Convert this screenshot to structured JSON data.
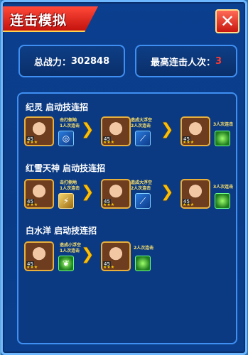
{
  "title": "连击模拟",
  "close_label": "✕",
  "stats": {
    "power_label": "总战力：",
    "power_value": "302848",
    "max_combo_label": "最高连击人次：",
    "max_combo_value": "3"
  },
  "combos": [
    {
      "title": "纪灵  启动技连招",
      "steps": [
        {
          "hero": "hero-ji-ling",
          "level": "45",
          "skill": "blue",
          "skill_icon": "swirl-icon",
          "desc": [
            "击打侧地",
            "1人次连击"
          ]
        },
        {
          "hero": "hero-red-hair",
          "level": "45",
          "skill": "blue",
          "skill_icon": "slash-icon",
          "desc": [
            "造成大浮空",
            "2人次连击"
          ]
        },
        {
          "hero": "hero-green-warrior",
          "level": "45",
          "skill": "green",
          "skill_icon": "orb-icon",
          "desc": [
            "3人次连击"
          ]
        }
      ]
    },
    {
      "title": "红雪天神  启动技连招",
      "steps": [
        {
          "hero": "hero-red-snow",
          "level": "45",
          "skill": "gold",
          "skill_icon": "lightning-icon",
          "desc": [
            "击打侧地",
            "1人次连击"
          ]
        },
        {
          "hero": "hero-red-hair",
          "level": "45",
          "skill": "blue",
          "skill_icon": "slash-icon",
          "desc": [
            "造成大浮空",
            "2人次连击"
          ]
        },
        {
          "hero": "hero-green-warrior",
          "level": "45",
          "skill": "green",
          "skill_icon": "orb-icon",
          "desc": [
            "3人次连击"
          ]
        }
      ]
    },
    {
      "title": "白水洋  启动技连招",
      "steps": [
        {
          "hero": "hero-white-hair",
          "level": "45",
          "skill": "green",
          "skill_icon": "leaf-icon",
          "desc": [
            "造成小浮空",
            "1人次连击"
          ]
        },
        {
          "hero": "hero-green-warrior",
          "level": "45",
          "skill": "green",
          "skill_icon": "orb-icon",
          "desc": [
            "2人次连击"
          ]
        }
      ]
    }
  ]
}
